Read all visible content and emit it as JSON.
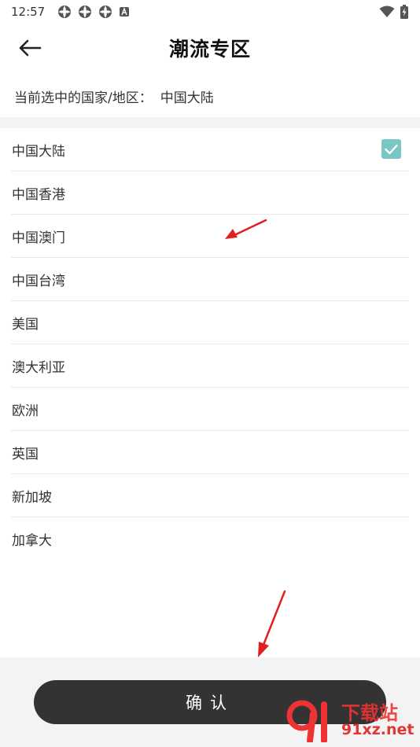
{
  "status_bar": {
    "time": "12:57"
  },
  "header": {
    "title": "潮流专区",
    "back_icon": "arrow-left-icon"
  },
  "current_region": {
    "label": "当前选中的国家/地区：",
    "value": "中国大陆"
  },
  "regions": [
    {
      "label": "中国大陆",
      "selected": true
    },
    {
      "label": "中国香港",
      "selected": false
    },
    {
      "label": "中国澳门",
      "selected": false
    },
    {
      "label": "中国台湾",
      "selected": false
    },
    {
      "label": "美国",
      "selected": false
    },
    {
      "label": "澳大利亚",
      "selected": false
    },
    {
      "label": "欧洲",
      "selected": false
    },
    {
      "label": "英国",
      "selected": false
    },
    {
      "label": "新加坡",
      "selected": false
    },
    {
      "label": "加拿大",
      "selected": false
    }
  ],
  "confirm_button": {
    "label": "确认"
  },
  "watermark": {
    "line1": "下载站",
    "line2": "91xz.net"
  },
  "colors": {
    "check_accent": "#79c7c2",
    "button_bg": "#333333",
    "arrow": "#e02020"
  }
}
